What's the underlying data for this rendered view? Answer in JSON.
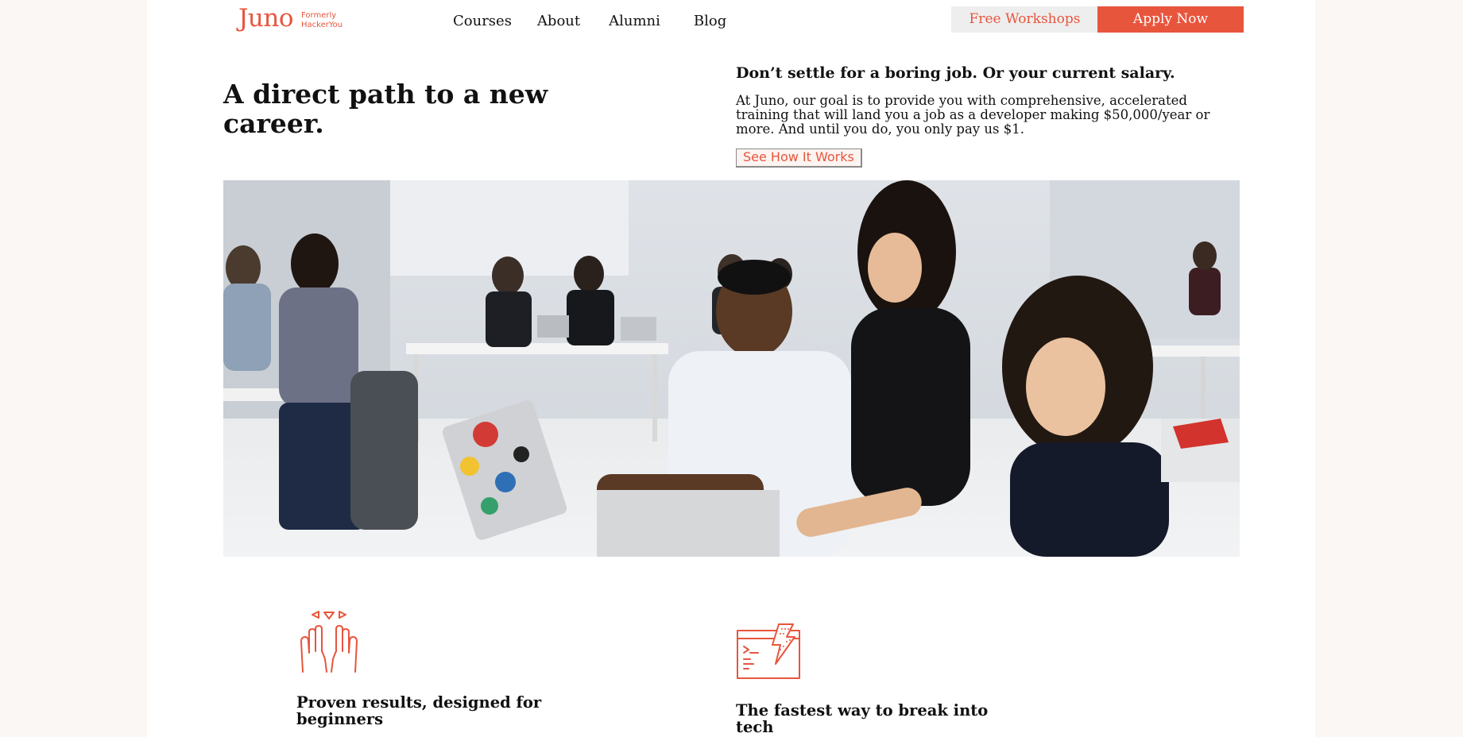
{
  "header": {
    "logo": {
      "name": "Juno",
      "subtitle": "Formerly HackerYou"
    },
    "nav": [
      {
        "label": "Courses"
      },
      {
        "label": "About"
      },
      {
        "label": "Alumni"
      },
      {
        "label": "Blog"
      }
    ],
    "workshops_label": "Free Workshops",
    "apply_label": "Apply Now"
  },
  "hero": {
    "title": "A direct path to a new career.",
    "subtitle": "Don’t settle for a boring job. Or your current salary.",
    "description": "At Juno, our goal is to provide you with comprehensive, accelerated training that will land you a job as a developer making $50,000/year or more. And until you do, you only pay us $1.",
    "cta_label": "See How It Works",
    "photo_icon": "classroom-photo"
  },
  "features": [
    {
      "icon": "raised-hands-icon",
      "title": "Proven results, designed for beginners"
    },
    {
      "icon": "code-window-lightning-icon",
      "title": "The fastest way to break into tech"
    }
  ],
  "colors": {
    "accent": "#e8553d",
    "outer_background": "#fbf7f4",
    "secondary_button": "#eeeeee"
  }
}
